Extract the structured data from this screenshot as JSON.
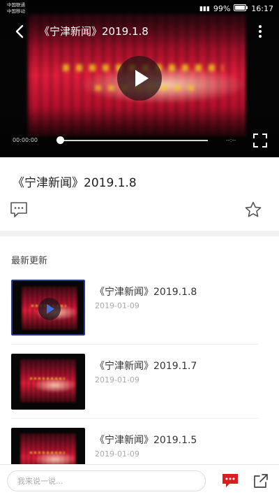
{
  "status_bar": {
    "carrier_1": "中国联通",
    "carrier_2": "中国移动",
    "battery": "99%",
    "time": "16:17"
  },
  "player": {
    "title": "《宁津新闻》2019.1.8",
    "current_time": "00:00:00",
    "total_time": "--:--",
    "progress": 0
  },
  "content": {
    "title": "《宁津新闻》2019.1.8"
  },
  "latest": {
    "section_title": "最新更新",
    "items": [
      {
        "title": "《宁津新闻》2019.1.8",
        "date": "2019-01-09"
      },
      {
        "title": "《宁津新闻》2019.1.7",
        "date": "2019-01-09"
      },
      {
        "title": "《宁津新闻》2019.1.5",
        "date": "2019-01-09"
      }
    ]
  },
  "bottom_bar": {
    "comment_placeholder": "我来说一说..."
  },
  "colors": {
    "accent": "#d81e1e",
    "text_primary": "#222222",
    "text_secondary": "#aaaaaa"
  }
}
